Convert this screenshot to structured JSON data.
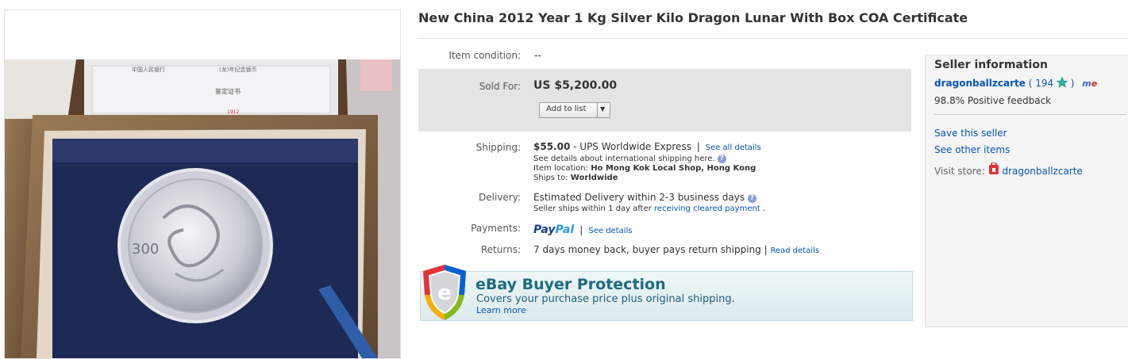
{
  "listing": {
    "title": "New China 2012 Year 1 Kg Silver Kilo Dragon Lunar With Box COA Certificate"
  },
  "details": {
    "condition_label": "Item condition:",
    "condition_value": "--",
    "sold_label": "Sold For:",
    "sold_price": "US $5,200.00",
    "add_to_list": "Add to list",
    "shipping_label": "Shipping:",
    "shipping_cost": "$55.00",
    "shipping_method": "- UPS Worldwide Express",
    "shipping_sep": "|",
    "see_all_details": "See all details",
    "intl_note": "See details about international shipping here.",
    "location_label": "Item location:",
    "location_value": "Ho Mong Kok Local Shop, Hong Kong",
    "ships_to_label": "Ships to:",
    "ships_to_value": "Worldwide",
    "delivery_label": "Delivery:",
    "delivery_value": "Estimated Delivery within 2-3 business days",
    "delivery_note_prefix": "Seller ships within 1 day after",
    "delivery_note_link": "receiving cleared payment",
    "delivery_note_suffix": ".",
    "payments_label": "Payments:",
    "paypal_pay": "Pay",
    "paypal_pal": "Pal",
    "payments_sep": "|",
    "payments_link": "See details",
    "returns_label": "Returns:",
    "returns_value": "7 days money back, buyer pays return shipping |",
    "returns_link": "Read details"
  },
  "buyer_protection": {
    "title": "eBay Buyer Protection",
    "subtitle": "Covers your purchase price plus original shipping.",
    "learn_more": "Learn more"
  },
  "seller": {
    "heading": "Seller information",
    "name": "dragonballzcarte",
    "feedback_score": "( 194",
    "close_paren": ")",
    "me_badge": "me",
    "positive": "98.8% Positive feedback",
    "save_seller": "Save this seller",
    "see_other": "See other items",
    "visit_label": "Visit store:",
    "store_name": "dragonballzcarte"
  },
  "icons": [
    "star-icon",
    "help-icon",
    "store-icon",
    "shield-icon",
    "dropdown-arrow-icon"
  ],
  "colors": {
    "link": "#0654ba",
    "price_box": "#e4e4e4",
    "star": "#2bb7a0",
    "me_red": "#e1251b",
    "me_blue": "#3366cc"
  }
}
